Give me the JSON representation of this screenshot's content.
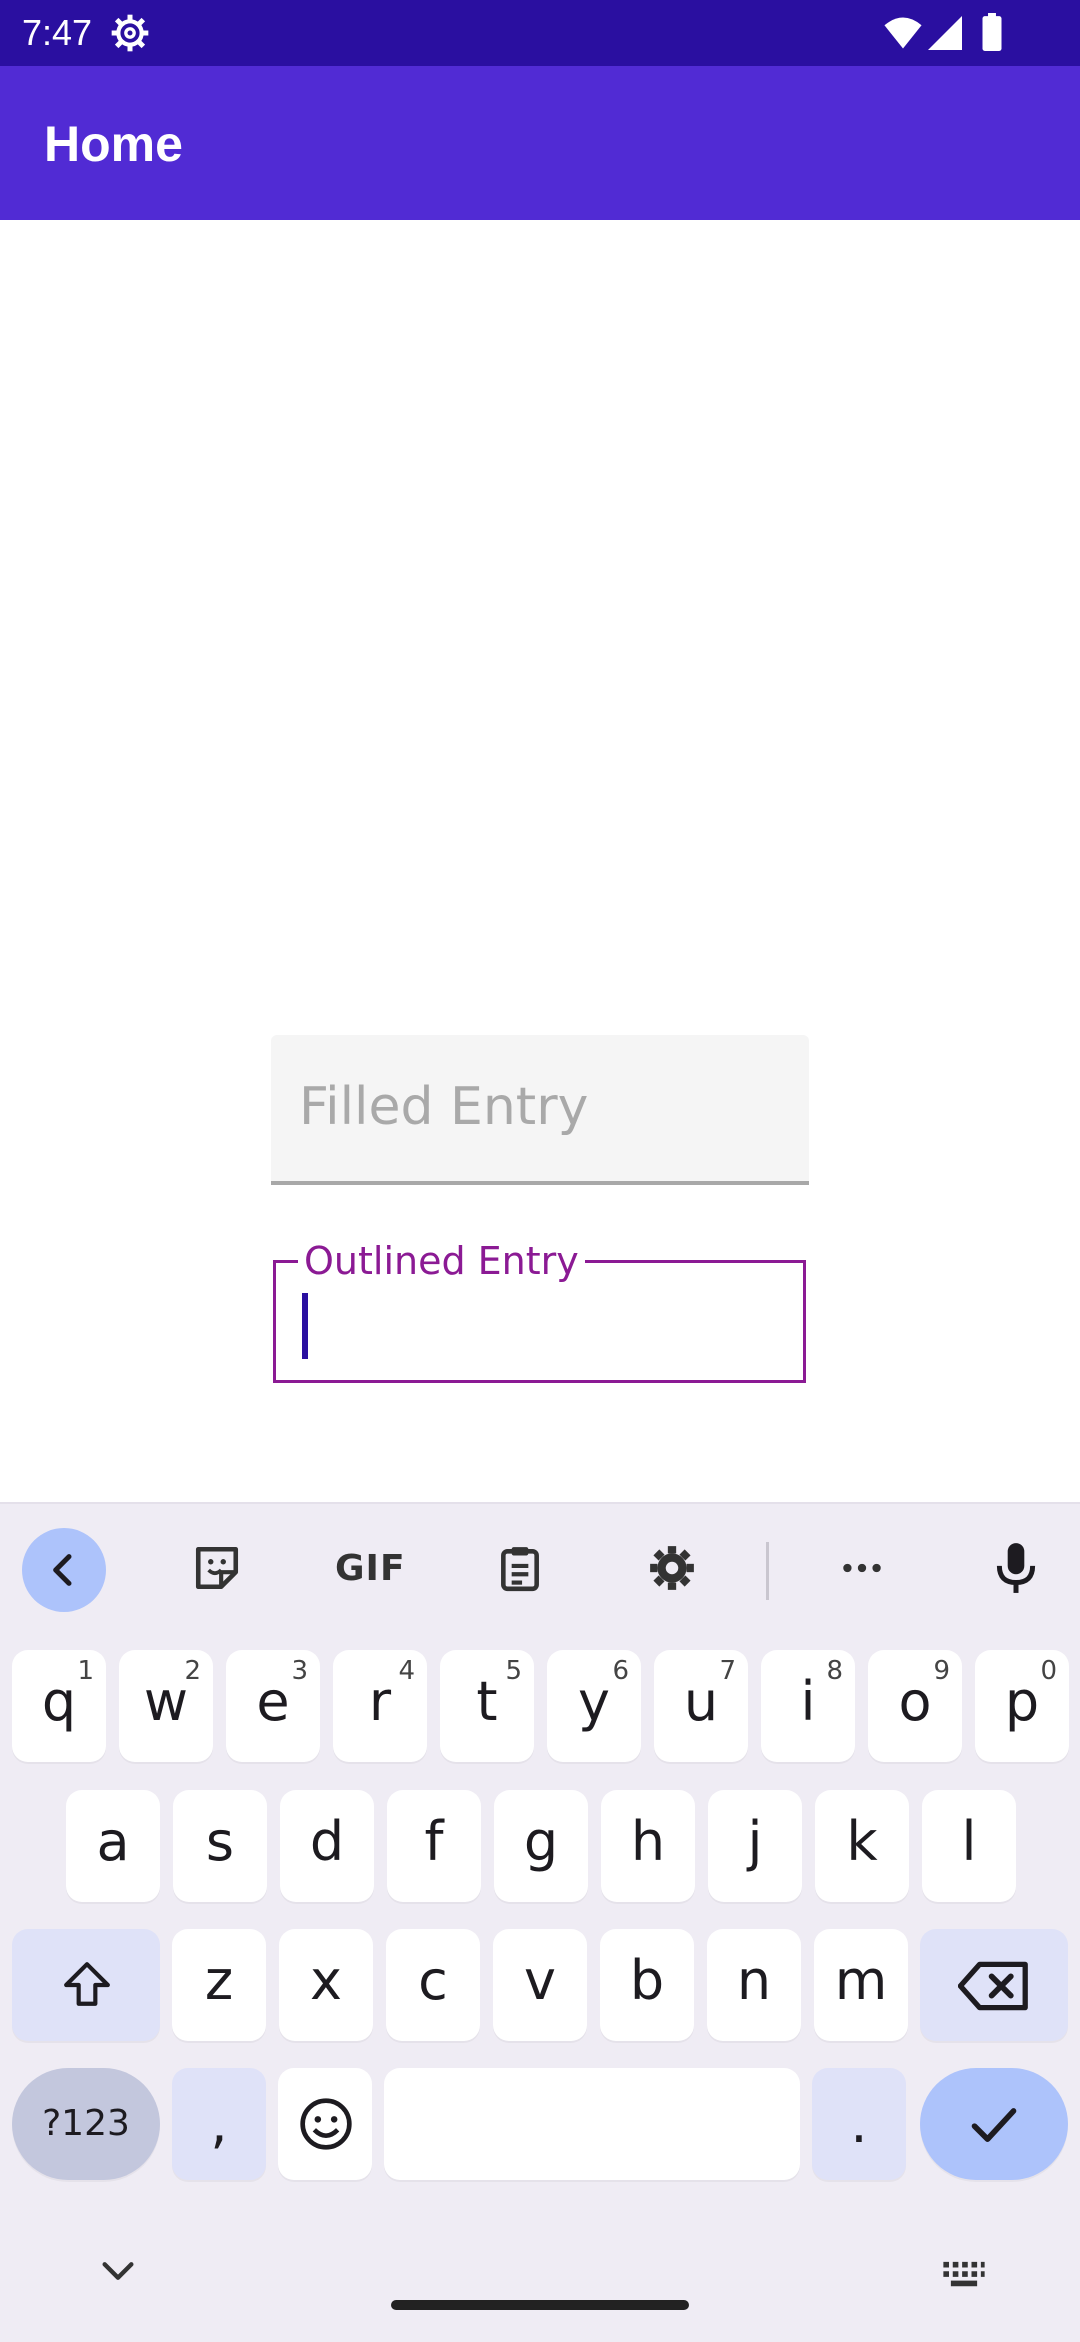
{
  "status_bar": {
    "time": "7:47",
    "icons": [
      "gear-icon",
      "wifi-icon",
      "signal-icon",
      "battery-icon"
    ]
  },
  "app_bar": {
    "title": "Home",
    "color": "#512bd4"
  },
  "filled_entry": {
    "placeholder": "Filled Entry",
    "value": ""
  },
  "outlined_entry": {
    "label": "Outlined Entry",
    "value": "",
    "accent": "#8b1a94"
  },
  "keyboard": {
    "toolbar": {
      "gif_label": "GIF",
      "icons": [
        "back-icon",
        "sticker-icon",
        "gif-icon",
        "clipboard-icon",
        "gear-icon",
        "more-icon",
        "mic-icon"
      ]
    },
    "row1": [
      {
        "l": "q",
        "h": "1"
      },
      {
        "l": "w",
        "h": "2"
      },
      {
        "l": "e",
        "h": "3"
      },
      {
        "l": "r",
        "h": "4"
      },
      {
        "l": "t",
        "h": "5"
      },
      {
        "l": "y",
        "h": "6"
      },
      {
        "l": "u",
        "h": "7"
      },
      {
        "l": "i",
        "h": "8"
      },
      {
        "l": "o",
        "h": "9"
      },
      {
        "l": "p",
        "h": "0"
      }
    ],
    "row2": [
      "a",
      "s",
      "d",
      "f",
      "g",
      "h",
      "j",
      "k",
      "l"
    ],
    "row3": [
      "z",
      "x",
      "c",
      "v",
      "b",
      "n",
      "m"
    ],
    "row4": {
      "sym": "?123",
      "comma": ",",
      "period": "."
    },
    "accent": "#adc3fb"
  }
}
